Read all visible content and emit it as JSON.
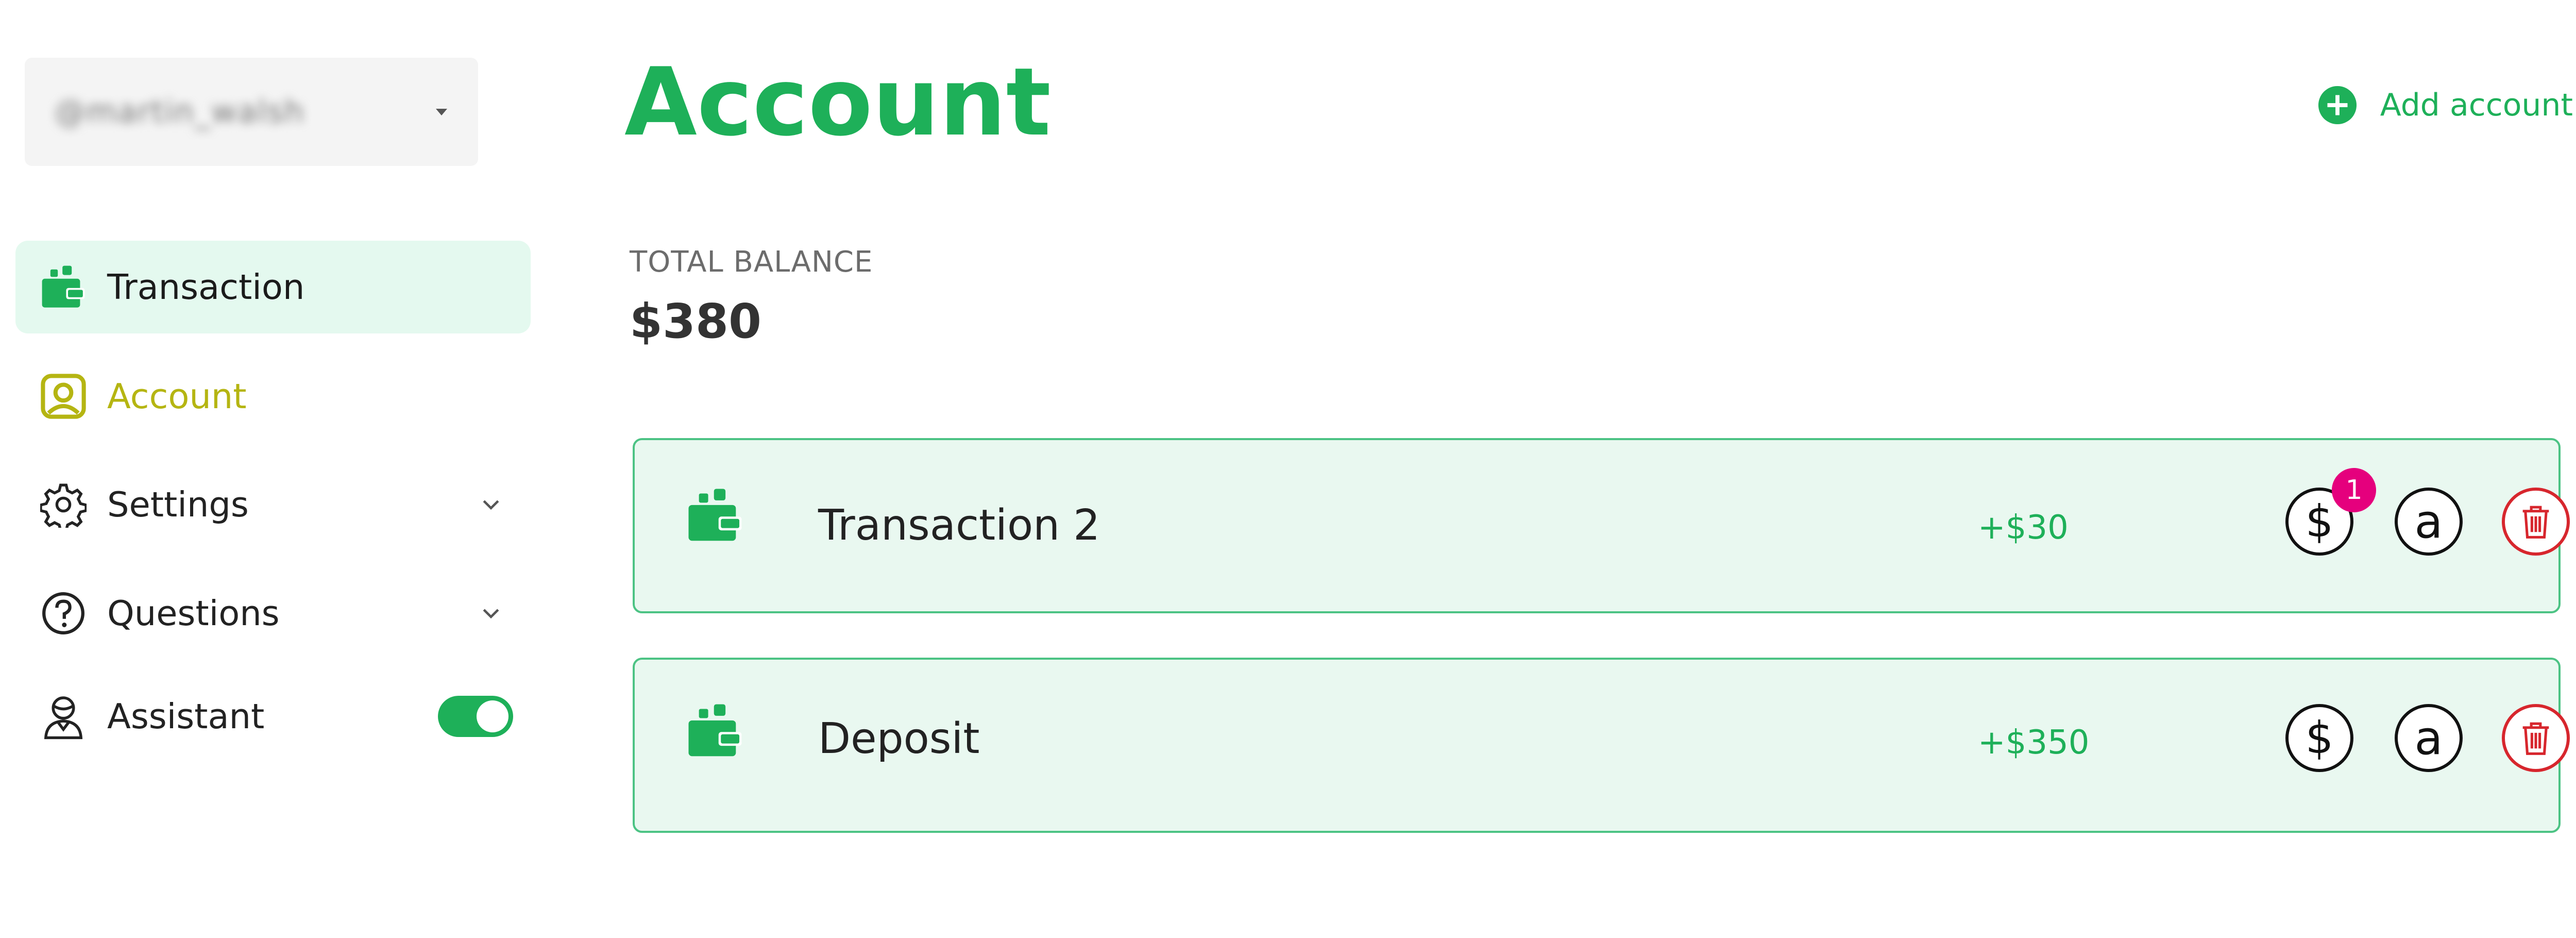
{
  "sidebar": {
    "user_switcher": {
      "username": "@martin_walsh"
    },
    "items": [
      {
        "label": "Transaction",
        "icon": "wallet-icon"
      },
      {
        "label": "Account",
        "icon": "user-account-icon"
      },
      {
        "label": "Settings",
        "icon": "gear-icon"
      },
      {
        "label": "Questions",
        "icon": "question-circle-icon"
      },
      {
        "label": "Assistant",
        "icon": "assistant-icon",
        "toggle_on": true
      }
    ]
  },
  "header": {
    "title": "Account",
    "add_account_label": "Add account"
  },
  "balance": {
    "label": "TOTAL BALANCE",
    "value": "$380"
  },
  "transactions": [
    {
      "name": "Transaction 2",
      "amount": "+$30",
      "badge": "1"
    },
    {
      "name": "Deposit",
      "amount": "+$350"
    }
  ],
  "actions": {
    "dollar_symbol": "$",
    "at_symbol": "a"
  },
  "colors": {
    "accent": "#1eb059",
    "active_nav_bg": "#e4f9ef",
    "highlight_nav": "#b5b512",
    "card_bg": "#e9f8f0",
    "card_border": "#4cc384",
    "delete": "#d7262d",
    "badge": "#e5007d"
  }
}
